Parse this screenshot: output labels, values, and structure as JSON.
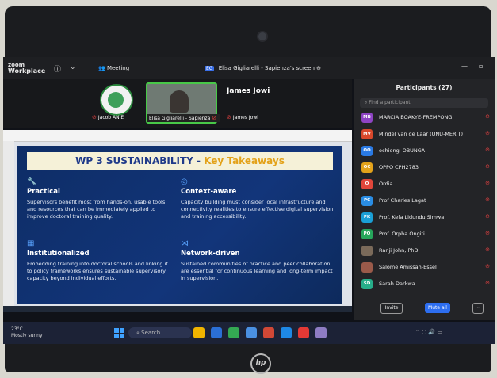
{
  "zoom": {
    "brand_line1": "zoom",
    "brand_line2": "Workplace",
    "meeting_label": "Meeting",
    "share_badge": "EG",
    "share_label": "Elisa Gigliarelli - Sapienza's screen"
  },
  "gallery": {
    "tile1_name": "Jacob ANIE",
    "tile2_name": "Elisa Gigliarelli - Sapienza",
    "tile3_name": "James Jowi",
    "tile3_big": "James Jowi"
  },
  "slide": {
    "title_main": "WP 3 SUSTAINABILITY - ",
    "title_accent": "Key Takeaways",
    "sections": [
      {
        "heading": "Practical",
        "body": "Supervisors benefit most from hands-on, usable tools and resources that can be immediately applied to improve doctoral training quality."
      },
      {
        "heading": "Context-aware",
        "body": "Capacity building must consider local infrastructure and connectivity realities to ensure effective digital supervision and training accessibility."
      },
      {
        "heading": "Institutionalized",
        "body": "Embedding training into doctoral schools and linking it to policy frameworks ensures sustainable supervisory capacity beyond individual efforts."
      },
      {
        "heading": "Network-driven",
        "body": "Sustained communities of practice and peer collaboration are essential for continuous learning and long-term impact in supervision."
      }
    ]
  },
  "participants": {
    "title": "Participants (27)",
    "search_placeholder": "Find a participant",
    "list": [
      {
        "initials": "MB",
        "name": "MARCIA BOAKYE-FREMPONG",
        "color": "#8e44c4"
      },
      {
        "initials": "MV",
        "name": "Mindel van de Laar (UNU-MERIT)",
        "color": "#d9482b"
      },
      {
        "initials": "OO",
        "name": "ochieng' OBUNGA",
        "color": "#2a7ae4"
      },
      {
        "initials": "OC",
        "name": "OPPO CPH2783",
        "color": "#e3a21a"
      },
      {
        "initials": "O",
        "name": "Ordia",
        "color": "#e0463a"
      },
      {
        "initials": "PC",
        "name": "Prof Charles Lagat",
        "color": "#2a8de4"
      },
      {
        "initials": "PK",
        "name": "Prof. Kefa Lidundu Simwa",
        "color": "#1a9fd6"
      },
      {
        "initials": "PO",
        "name": "Prof. Orpha Ongiti",
        "color": "#26a65b"
      },
      {
        "initials": "",
        "name": "Ranji John, PhD",
        "color": "#7a6a5a"
      },
      {
        "initials": "",
        "name": "Salome Amissah-Essel",
        "color": "#9a5a4a"
      },
      {
        "initials": "SD",
        "name": "Sarah Darkwa",
        "color": "#27ae8a"
      }
    ],
    "invite_label": "Invite",
    "muteall_label": "Mute all"
  },
  "taskbar": {
    "weather_temp": "23°C",
    "weather_desc": "Mostly sunny",
    "search_label": "Search"
  },
  "bezel": {
    "logo": "hp"
  }
}
